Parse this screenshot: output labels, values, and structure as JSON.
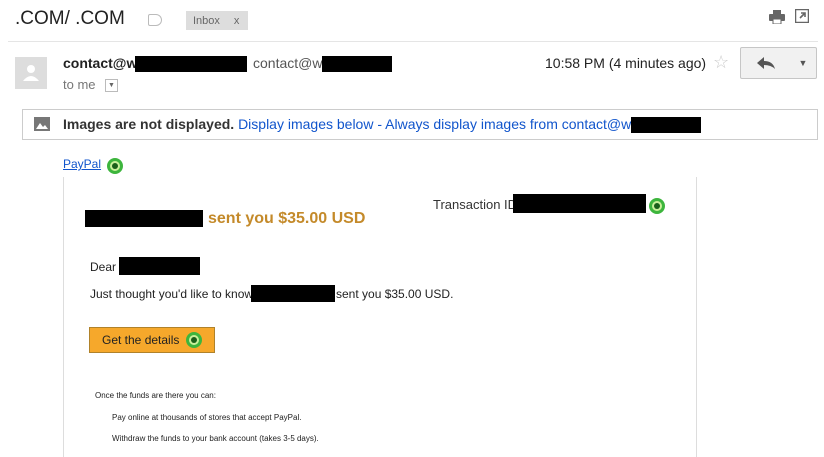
{
  "header": {
    "subject": ".COM/ .COM",
    "label_chip": "Inbox",
    "label_close": "x"
  },
  "message": {
    "sender_name": "contact@w          .com",
    "sender_email": "contact@w           .com",
    "recipient": "to me",
    "timestamp": "10:58 PM (4 minutes ago)"
  },
  "images_banner": {
    "notice": "Images are not displayed.",
    "display_link": "Display images below",
    "separator": "-",
    "always_link": "Always display images from contact@w           .com"
  },
  "email_body": {
    "brand_link": "PayPal",
    "transaction_label": "Transaction ID",
    "headline": "sent you $35.00 USD",
    "greeting": "Dear",
    "message_prefix": "Just thought you'd like to know",
    "message_suffix": "sent you $35.00 USD.",
    "cta_button": "Get the details",
    "funds_intro": "Once the funds are there you can:",
    "funds_options": [
      "Pay online at thousands of stores that accept PayPal.",
      "Withdraw the funds to your bank account (takes 3-5 days)."
    ]
  },
  "colors": {
    "link": "#1155cc",
    "headline": "#c48a2a",
    "cta_background": "#f6a82b",
    "redaction": "#000000"
  },
  "icons": [
    "label-icon",
    "print-icon",
    "new-window-icon",
    "avatar-icon",
    "star-icon",
    "reply-icon",
    "more-dropdown-icon",
    "image-icon",
    "paypal-ring-icon"
  ]
}
